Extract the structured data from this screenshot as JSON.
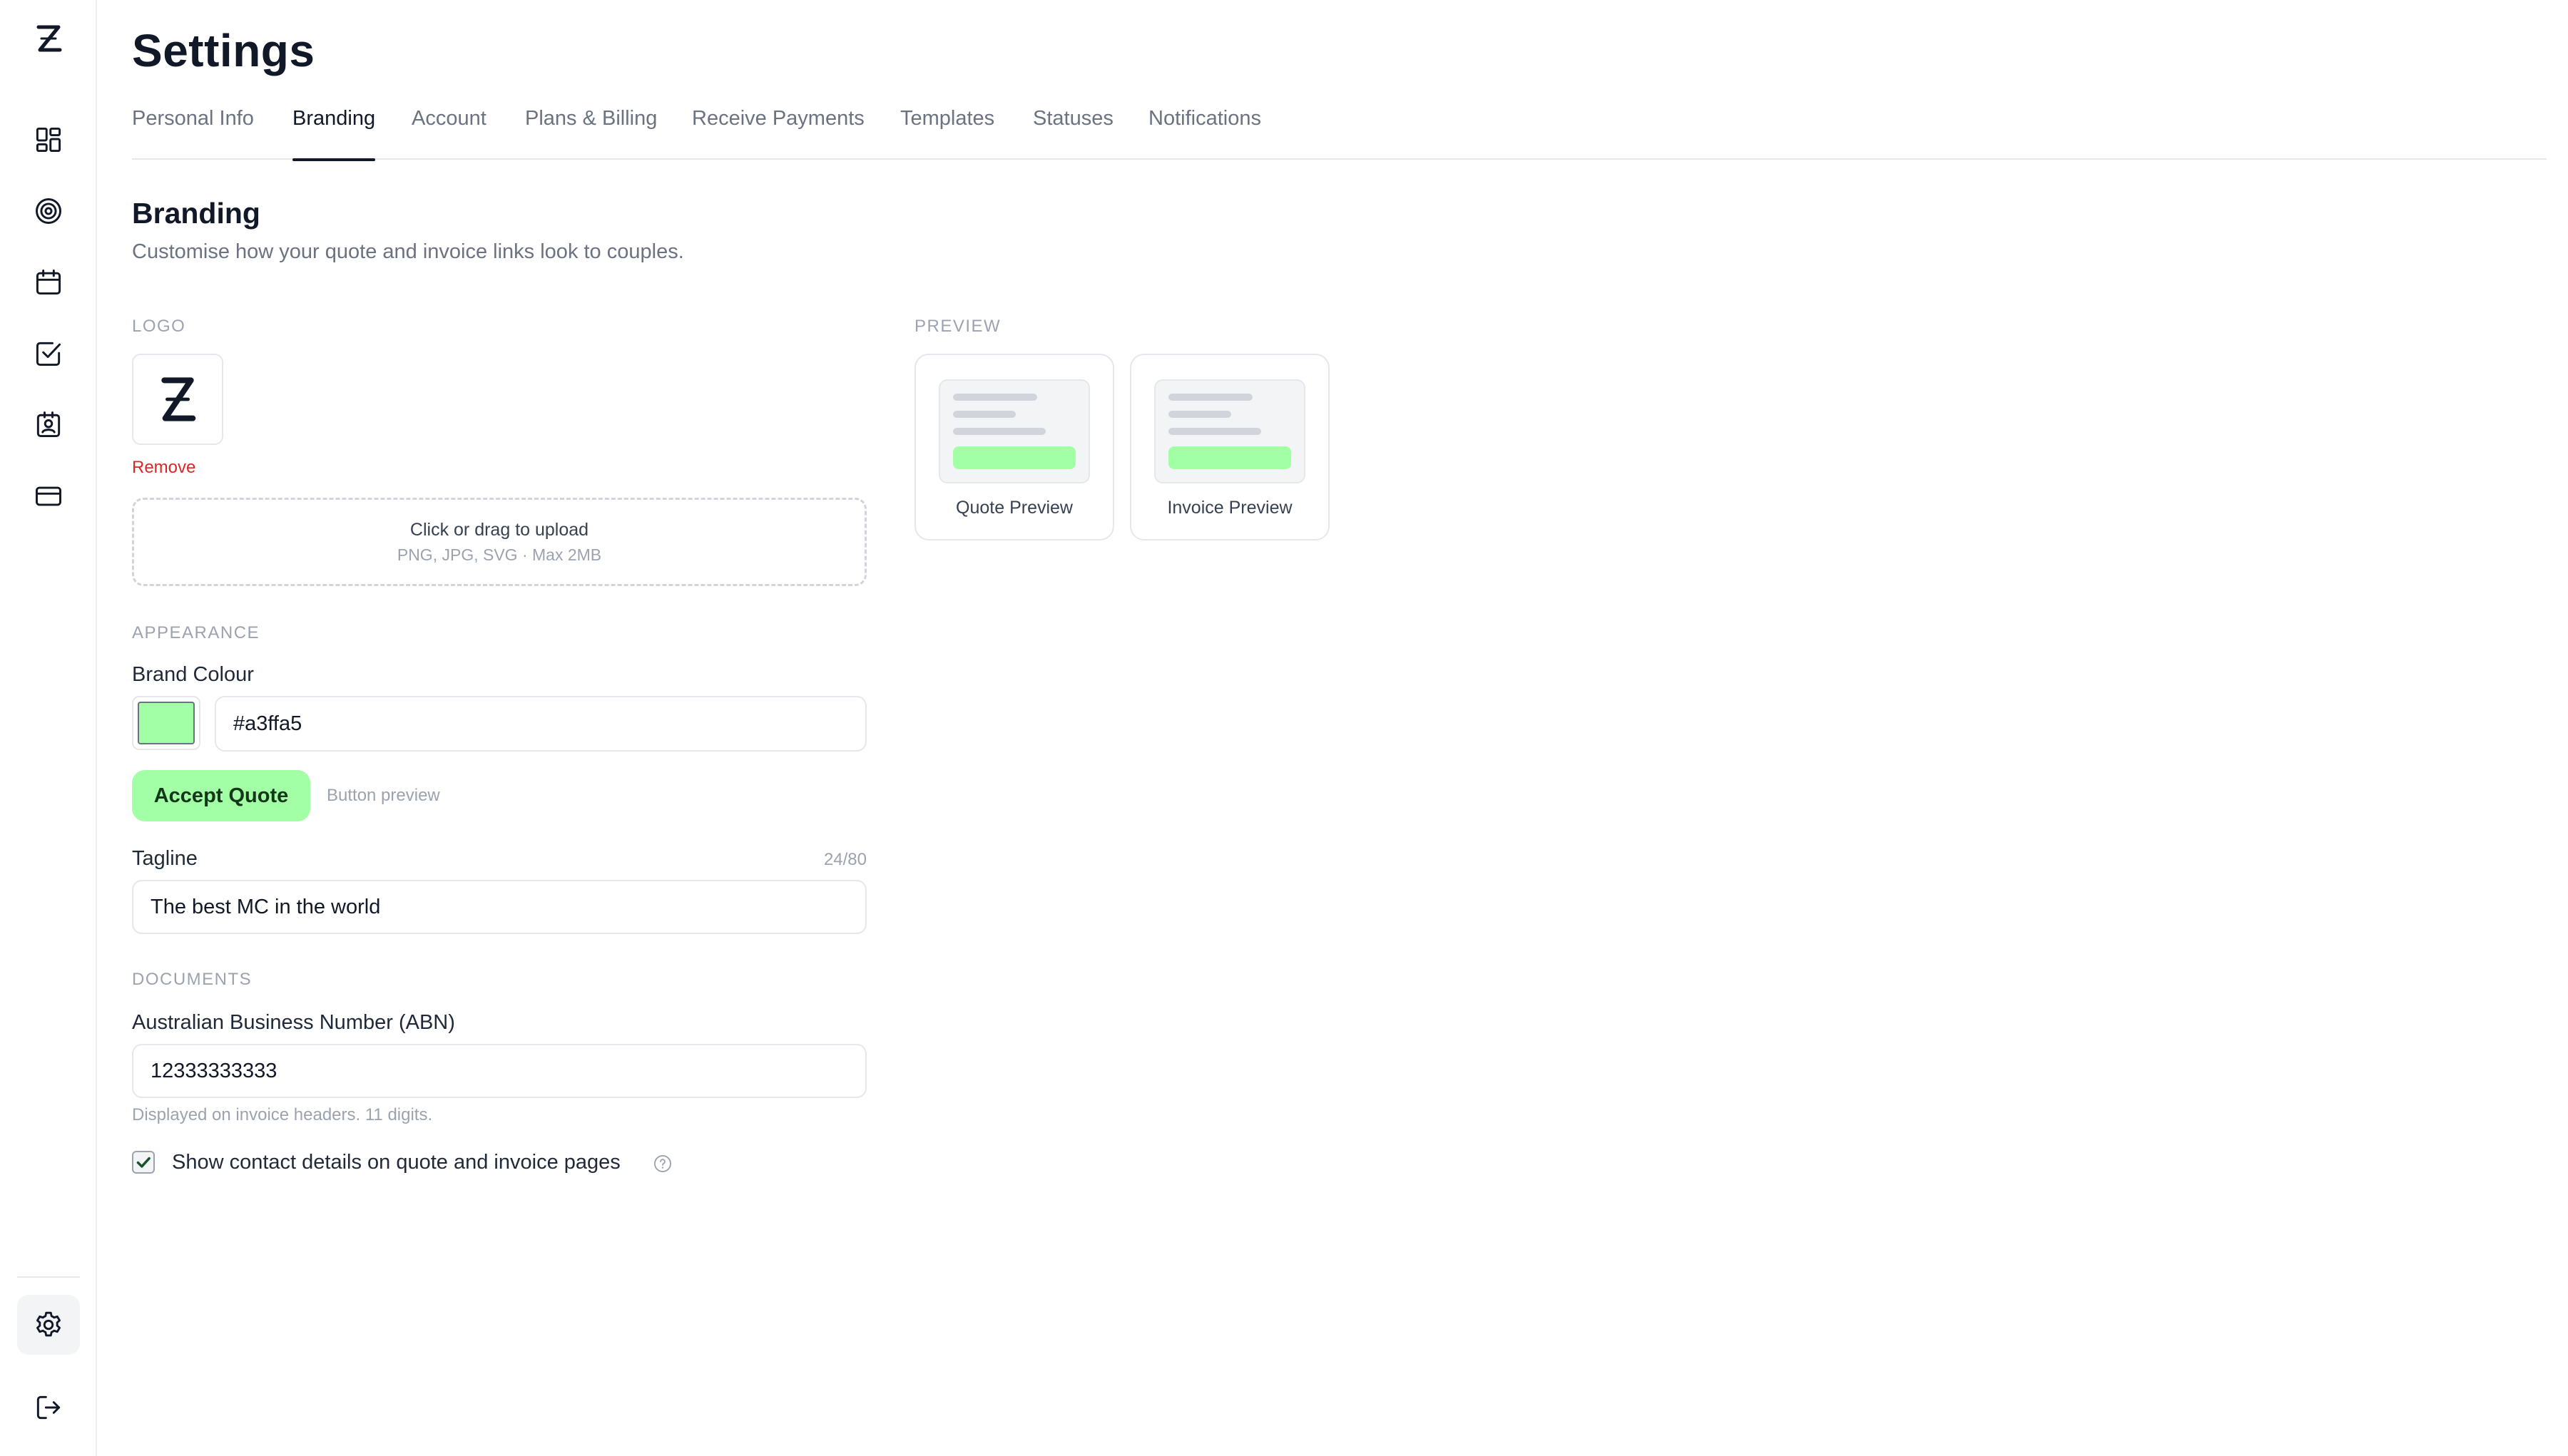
{
  "page": {
    "title": "Settings",
    "tabs": [
      {
        "label": "Personal Info",
        "active": false
      },
      {
        "label": "Branding",
        "active": true
      },
      {
        "label": "Account",
        "active": false
      },
      {
        "label": "Plans & Billing",
        "active": false
      },
      {
        "label": "Receive Payments",
        "active": false
      },
      {
        "label": "Templates",
        "active": false
      },
      {
        "label": "Statuses",
        "active": false
      },
      {
        "label": "Notifications",
        "active": false
      }
    ]
  },
  "branding": {
    "title": "Branding",
    "subtitle": "Customise how your quote and invoice links look to couples.",
    "logo_section": "LOGO",
    "remove_label": "Remove",
    "upload_title": "Click or drag to upload",
    "upload_hint": "PNG, JPG, SVG · Max 2MB",
    "appearance_section": "APPEARANCE",
    "brand_colour_label": "Brand Colour",
    "brand_colour_value": "#a3ffa5",
    "accept_button_label": "Accept Quote",
    "button_preview_note": "Button preview",
    "tagline_label": "Tagline",
    "tagline_counter": "24/80",
    "tagline_value": "The best MC in the world",
    "documents_section": "DOCUMENTS",
    "abn_label": "Australian Business Number (ABN)",
    "abn_value": "12333333333",
    "abn_helper": "Displayed on invoice headers. 11 digits.",
    "show_contact_label": "Show contact details on quote and invoice pages",
    "show_contact_checked": true
  },
  "preview": {
    "section": "PREVIEW",
    "quote_label": "Quote Preview",
    "invoice_label": "Invoice Preview"
  },
  "colors": {
    "brand": "#a3ffa5",
    "danger": "#dc2626",
    "text": "#111827",
    "muted": "#6b7280"
  },
  "sidebar": {
    "icons": [
      "brand-logo",
      "dashboard-icon",
      "target-icon",
      "calendar-icon",
      "task-check-icon",
      "contacts-icon",
      "card-icon",
      "settings-icon",
      "logout-icon"
    ]
  }
}
